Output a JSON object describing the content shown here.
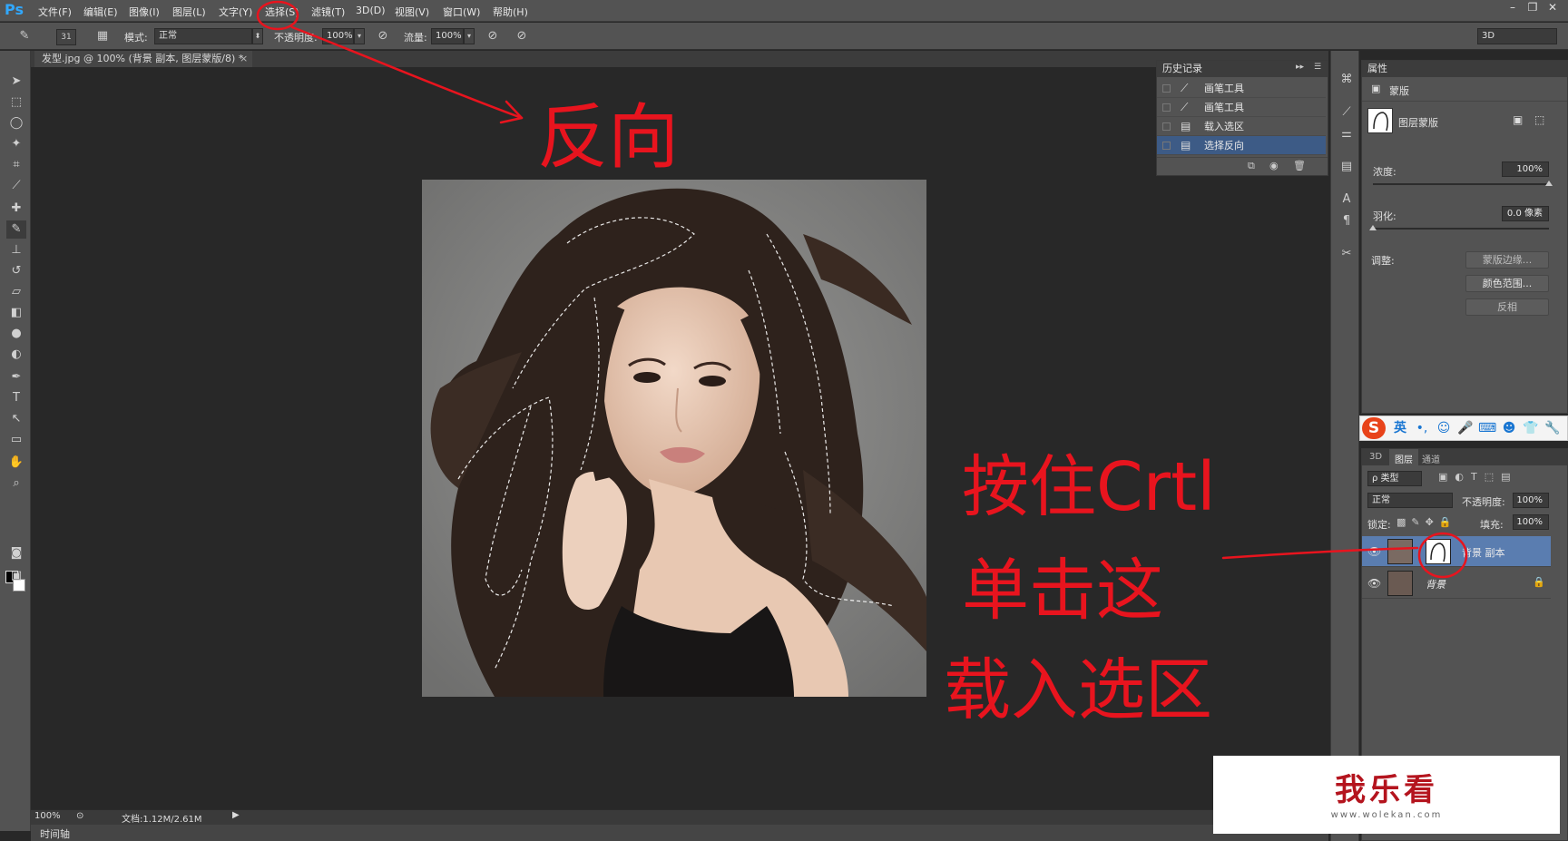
{
  "app": {
    "logo": "Ps",
    "menu": [
      "文件(F)",
      "编辑(E)",
      "图像(I)",
      "图层(L)",
      "文字(Y)",
      "选择(S)",
      "滤镜(T)",
      "3D(D)",
      "视图(V)",
      "窗口(W)",
      "帮助(H)"
    ],
    "window_controls": [
      "–",
      "❐",
      "✕"
    ]
  },
  "options_bar": {
    "brush_size": "31",
    "mode_label": "模式:",
    "mode_value": "正常",
    "opacity_label": "不透明度:",
    "opacity_value": "100%",
    "flow_label": "流量:",
    "flow_value": "100%",
    "workspace": "3D"
  },
  "document": {
    "tab_title": "发型.jpg @ 100% (背景 副本, 图层蒙版/8) *",
    "close": "×"
  },
  "status_bar": {
    "zoom": "100%",
    "doc_size": "文档:1.12M/2.61M",
    "timeline": "时间轴"
  },
  "history_panel": {
    "title": "历史记录",
    "items": [
      {
        "label": "画笔工具",
        "icon": "brush-icon",
        "active": false
      },
      {
        "label": "画笔工具",
        "icon": "brush-icon",
        "active": false
      },
      {
        "label": "载入选区",
        "icon": "document-icon",
        "active": false
      },
      {
        "label": "选择反向",
        "icon": "document-icon",
        "active": true
      }
    ]
  },
  "properties_panel": {
    "title": "属性",
    "section": "蒙版",
    "mask_type": "图层蒙版",
    "density_label": "浓度:",
    "density_value": "100%",
    "density_level": 1.0,
    "feather_label": "羽化:",
    "feather_value": "0.0 像素",
    "feather_level": 0.0,
    "adjust_label": "调整:",
    "buttons": [
      "蒙版边缘...",
      "颜色范围...",
      "反相"
    ]
  },
  "layers_panel": {
    "tabs": [
      "3D",
      "图层",
      "通道"
    ],
    "filter_label": "ρ 类型",
    "blend_mode": "正常",
    "opacity_label": "不透明度:",
    "opacity_value": "100%",
    "lock_label": "锁定:",
    "fill_label": "填充:",
    "fill_value": "100%",
    "layers": [
      {
        "name": "背景 副本",
        "active": true,
        "has_mask": true
      },
      {
        "name": "背景",
        "active": false,
        "has_mask": false
      }
    ]
  },
  "ime_bar": {
    "logo": "S",
    "lang": "英"
  },
  "annotations": {
    "arrow_top_text": "反向",
    "instruction_line1": "按住Crtl",
    "instruction_line2": "单击这",
    "instruction_line3": "载入选区"
  },
  "watermark": {
    "text": "我乐看",
    "url": "www.wolekan.com"
  },
  "colors": {
    "accent_red": "#e8141e",
    "active_row": "#3d5b86",
    "layer_active": "#5a7db0",
    "ps_blue": "#31a8ff"
  }
}
